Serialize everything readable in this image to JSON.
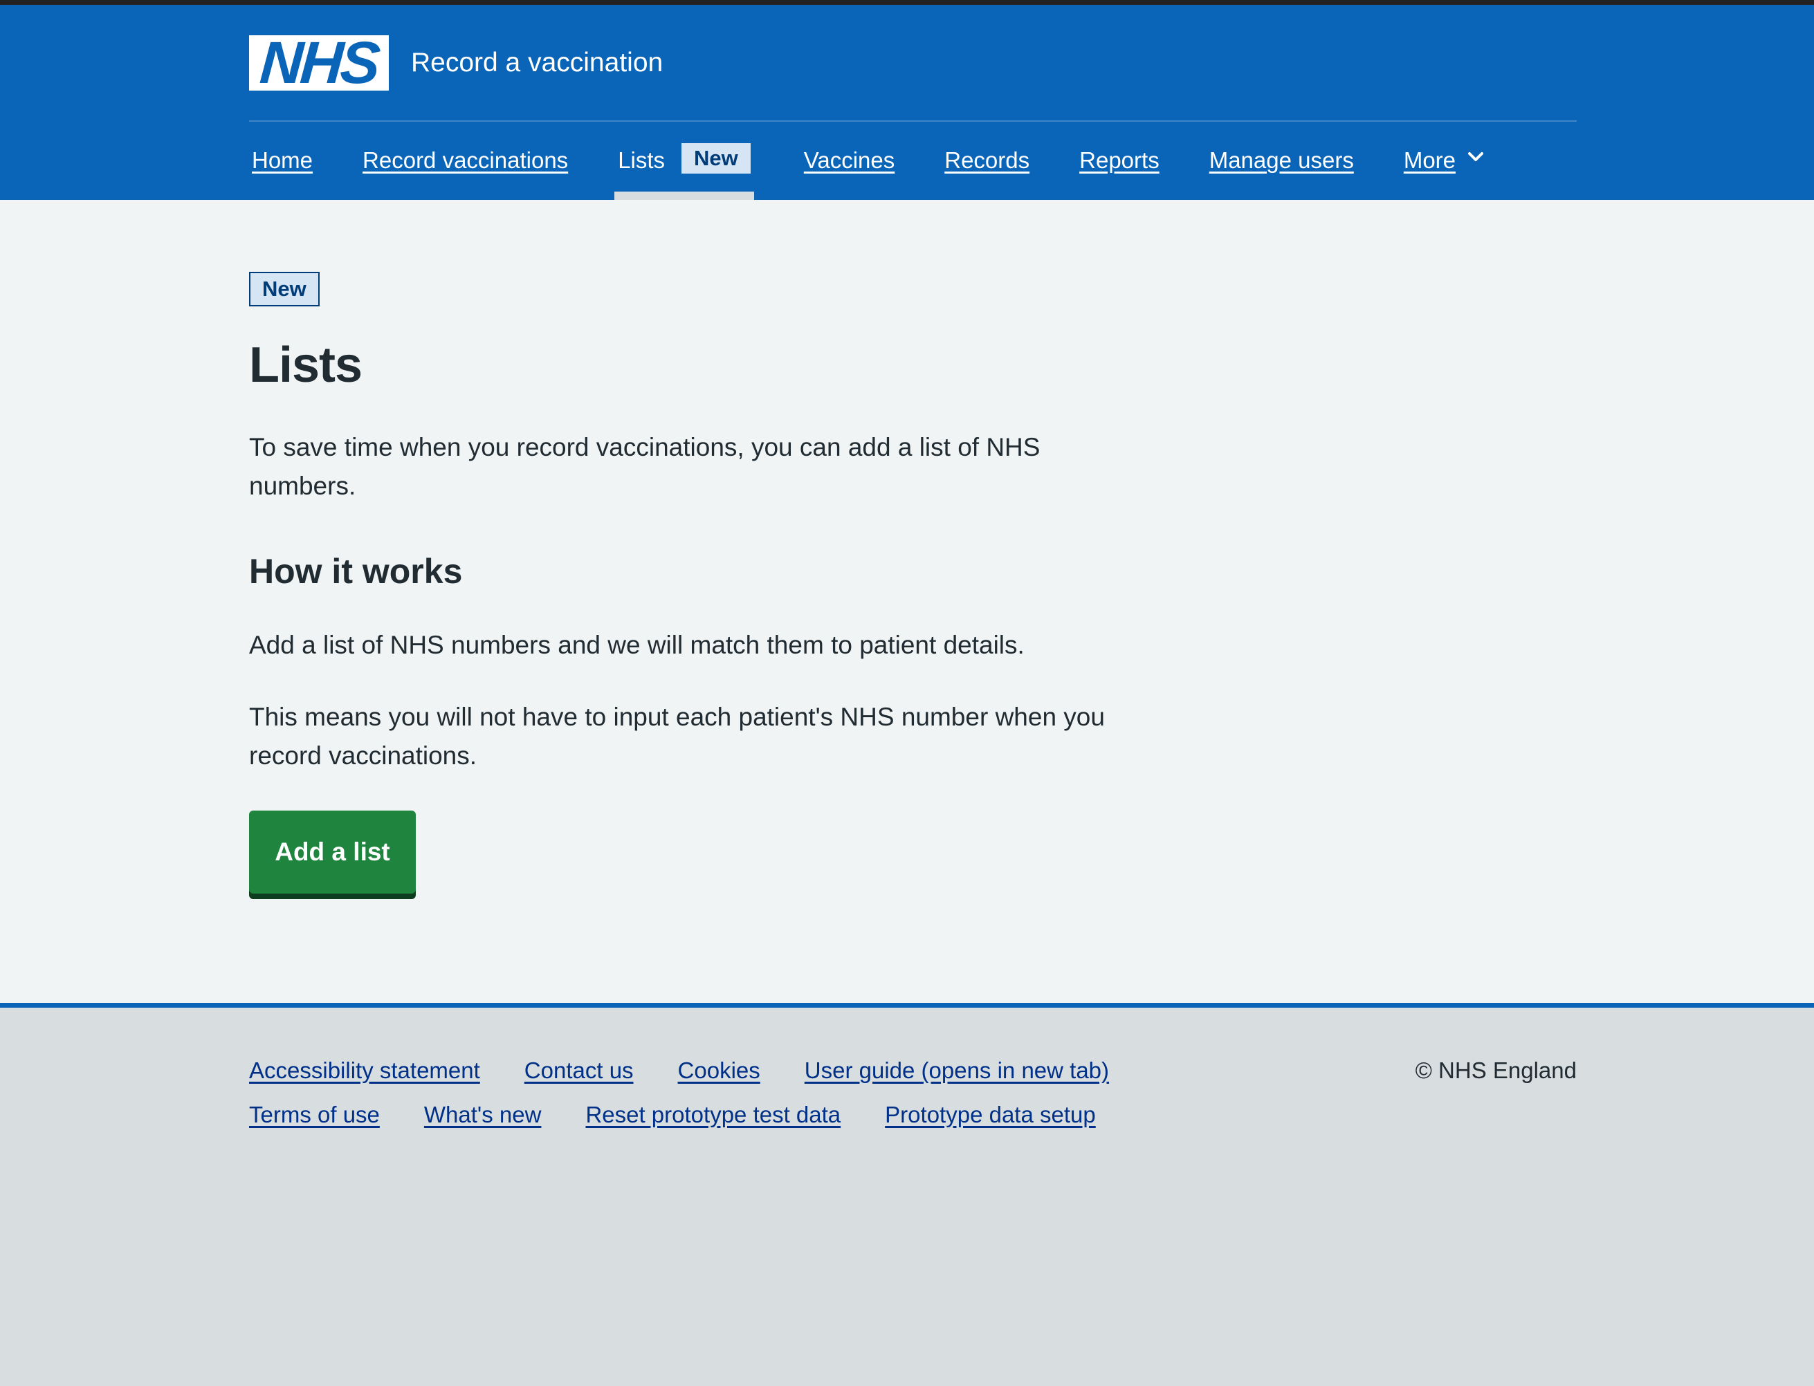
{
  "header": {
    "logo_text": "NHS",
    "service_name": "Record a vaccination"
  },
  "nav": {
    "items": [
      {
        "label": "Home"
      },
      {
        "label": "Record vaccinations"
      },
      {
        "label": "Lists",
        "tag": "New",
        "current": true
      },
      {
        "label": "Vaccines"
      },
      {
        "label": "Records"
      },
      {
        "label": "Reports"
      },
      {
        "label": "Manage users"
      },
      {
        "label": "More"
      }
    ]
  },
  "main": {
    "badge": "New",
    "title": "Lists",
    "intro": "To save time when you record vaccinations, you can add a list of NHS numbers.",
    "section_heading": "How it works",
    "para1": "Add a list of NHS numbers and we will match them to patient details.",
    "para2": "This means you will not have to input each patient's NHS number when you record vaccinations.",
    "button_label": "Add a list"
  },
  "footer": {
    "row1": [
      "Accessibility statement",
      "Contact us",
      "Cookies",
      "User guide (opens in new tab)"
    ],
    "row2": [
      "Terms of use",
      "What's new",
      "Reset prototype test data",
      "Prototype data setup"
    ],
    "copyright": "© NHS England"
  },
  "colors": {
    "header_blue": "#0a65b8",
    "button_green": "#1f843e",
    "page_bg": "#f0f4f5",
    "footer_bg": "#d8dde0",
    "link_blue": "#003087"
  }
}
